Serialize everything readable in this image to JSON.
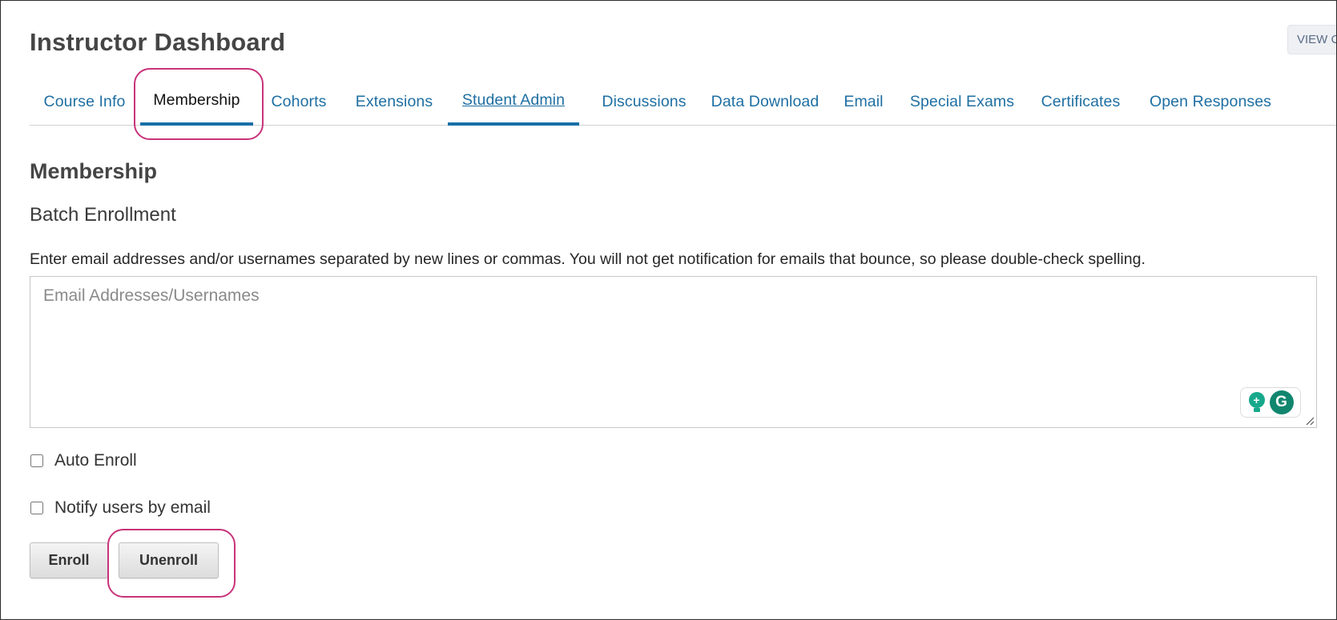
{
  "header": {
    "title": "Instructor Dashboard",
    "view_button_label": "VIEW COURSE"
  },
  "tabs": [
    {
      "label": "Course Info",
      "state": "normal"
    },
    {
      "label": "Membership",
      "state": "active"
    },
    {
      "label": "Cohorts",
      "state": "normal"
    },
    {
      "label": "Extensions",
      "state": "normal"
    },
    {
      "label": "Student Admin",
      "state": "hover"
    },
    {
      "label": "Discussions",
      "state": "normal"
    },
    {
      "label": "Data Download",
      "state": "normal"
    },
    {
      "label": "Email",
      "state": "normal"
    },
    {
      "label": "Special Exams",
      "state": "normal"
    },
    {
      "label": "Certificates",
      "state": "normal"
    },
    {
      "label": "Open Responses",
      "state": "normal"
    }
  ],
  "membership": {
    "section_title": "Membership",
    "batch_title": "Batch Enrollment",
    "instructions": "Enter email addresses and/or usernames separated by new lines or commas. You will not get notification for emails that bounce, so please double-check spelling.",
    "textarea_placeholder": "Email Addresses/Usernames",
    "textarea_value": "",
    "auto_enroll_label": "Auto Enroll",
    "auto_enroll_checked": false,
    "notify_label": "Notify users by email",
    "notify_checked": false,
    "enroll_label": "Enroll",
    "unenroll_label": "Unenroll"
  },
  "grammarly": {
    "bulb_icon": "lightbulb-icon",
    "logo_icon": "grammarly-icon",
    "logo_letter": "G"
  },
  "colors": {
    "tab_link": "#1f6fa3",
    "tab_active_underline": "#1a6fa8",
    "annotation": "#c8337a",
    "grammarly_green": "#11866f"
  }
}
